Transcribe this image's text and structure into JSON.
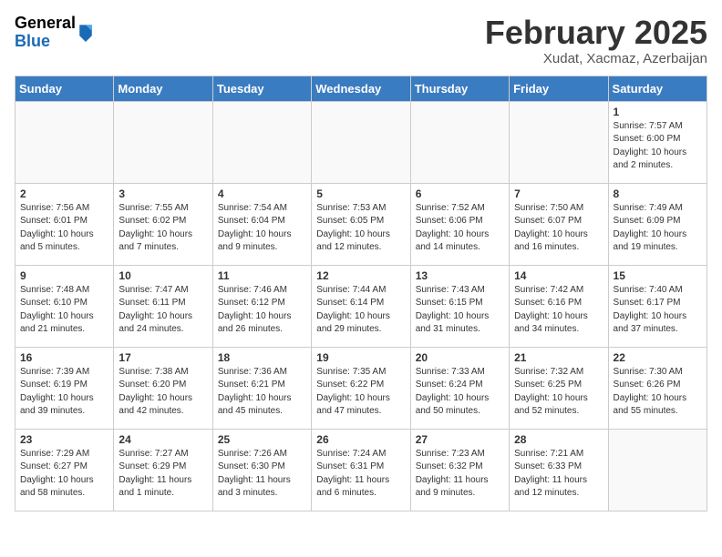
{
  "header": {
    "logo_general": "General",
    "logo_blue": "Blue",
    "month_title": "February 2025",
    "subtitle": "Xudat, Xacmaz, Azerbaijan"
  },
  "days_of_week": [
    "Sunday",
    "Monday",
    "Tuesday",
    "Wednesday",
    "Thursday",
    "Friday",
    "Saturday"
  ],
  "weeks": [
    [
      {
        "day": "",
        "info": ""
      },
      {
        "day": "",
        "info": ""
      },
      {
        "day": "",
        "info": ""
      },
      {
        "day": "",
        "info": ""
      },
      {
        "day": "",
        "info": ""
      },
      {
        "day": "",
        "info": ""
      },
      {
        "day": "1",
        "info": "Sunrise: 7:57 AM\nSunset: 6:00 PM\nDaylight: 10 hours and 2 minutes."
      }
    ],
    [
      {
        "day": "2",
        "info": "Sunrise: 7:56 AM\nSunset: 6:01 PM\nDaylight: 10 hours and 5 minutes."
      },
      {
        "day": "3",
        "info": "Sunrise: 7:55 AM\nSunset: 6:02 PM\nDaylight: 10 hours and 7 minutes."
      },
      {
        "day": "4",
        "info": "Sunrise: 7:54 AM\nSunset: 6:04 PM\nDaylight: 10 hours and 9 minutes."
      },
      {
        "day": "5",
        "info": "Sunrise: 7:53 AM\nSunset: 6:05 PM\nDaylight: 10 hours and 12 minutes."
      },
      {
        "day": "6",
        "info": "Sunrise: 7:52 AM\nSunset: 6:06 PM\nDaylight: 10 hours and 14 minutes."
      },
      {
        "day": "7",
        "info": "Sunrise: 7:50 AM\nSunset: 6:07 PM\nDaylight: 10 hours and 16 minutes."
      },
      {
        "day": "8",
        "info": "Sunrise: 7:49 AM\nSunset: 6:09 PM\nDaylight: 10 hours and 19 minutes."
      }
    ],
    [
      {
        "day": "9",
        "info": "Sunrise: 7:48 AM\nSunset: 6:10 PM\nDaylight: 10 hours and 21 minutes."
      },
      {
        "day": "10",
        "info": "Sunrise: 7:47 AM\nSunset: 6:11 PM\nDaylight: 10 hours and 24 minutes."
      },
      {
        "day": "11",
        "info": "Sunrise: 7:46 AM\nSunset: 6:12 PM\nDaylight: 10 hours and 26 minutes."
      },
      {
        "day": "12",
        "info": "Sunrise: 7:44 AM\nSunset: 6:14 PM\nDaylight: 10 hours and 29 minutes."
      },
      {
        "day": "13",
        "info": "Sunrise: 7:43 AM\nSunset: 6:15 PM\nDaylight: 10 hours and 31 minutes."
      },
      {
        "day": "14",
        "info": "Sunrise: 7:42 AM\nSunset: 6:16 PM\nDaylight: 10 hours and 34 minutes."
      },
      {
        "day": "15",
        "info": "Sunrise: 7:40 AM\nSunset: 6:17 PM\nDaylight: 10 hours and 37 minutes."
      }
    ],
    [
      {
        "day": "16",
        "info": "Sunrise: 7:39 AM\nSunset: 6:19 PM\nDaylight: 10 hours and 39 minutes."
      },
      {
        "day": "17",
        "info": "Sunrise: 7:38 AM\nSunset: 6:20 PM\nDaylight: 10 hours and 42 minutes."
      },
      {
        "day": "18",
        "info": "Sunrise: 7:36 AM\nSunset: 6:21 PM\nDaylight: 10 hours and 45 minutes."
      },
      {
        "day": "19",
        "info": "Sunrise: 7:35 AM\nSunset: 6:22 PM\nDaylight: 10 hours and 47 minutes."
      },
      {
        "day": "20",
        "info": "Sunrise: 7:33 AM\nSunset: 6:24 PM\nDaylight: 10 hours and 50 minutes."
      },
      {
        "day": "21",
        "info": "Sunrise: 7:32 AM\nSunset: 6:25 PM\nDaylight: 10 hours and 52 minutes."
      },
      {
        "day": "22",
        "info": "Sunrise: 7:30 AM\nSunset: 6:26 PM\nDaylight: 10 hours and 55 minutes."
      }
    ],
    [
      {
        "day": "23",
        "info": "Sunrise: 7:29 AM\nSunset: 6:27 PM\nDaylight: 10 hours and 58 minutes."
      },
      {
        "day": "24",
        "info": "Sunrise: 7:27 AM\nSunset: 6:29 PM\nDaylight: 11 hours and 1 minute."
      },
      {
        "day": "25",
        "info": "Sunrise: 7:26 AM\nSunset: 6:30 PM\nDaylight: 11 hours and 3 minutes."
      },
      {
        "day": "26",
        "info": "Sunrise: 7:24 AM\nSunset: 6:31 PM\nDaylight: 11 hours and 6 minutes."
      },
      {
        "day": "27",
        "info": "Sunrise: 7:23 AM\nSunset: 6:32 PM\nDaylight: 11 hours and 9 minutes."
      },
      {
        "day": "28",
        "info": "Sunrise: 7:21 AM\nSunset: 6:33 PM\nDaylight: 11 hours and 12 minutes."
      },
      {
        "day": "",
        "info": ""
      }
    ]
  ]
}
